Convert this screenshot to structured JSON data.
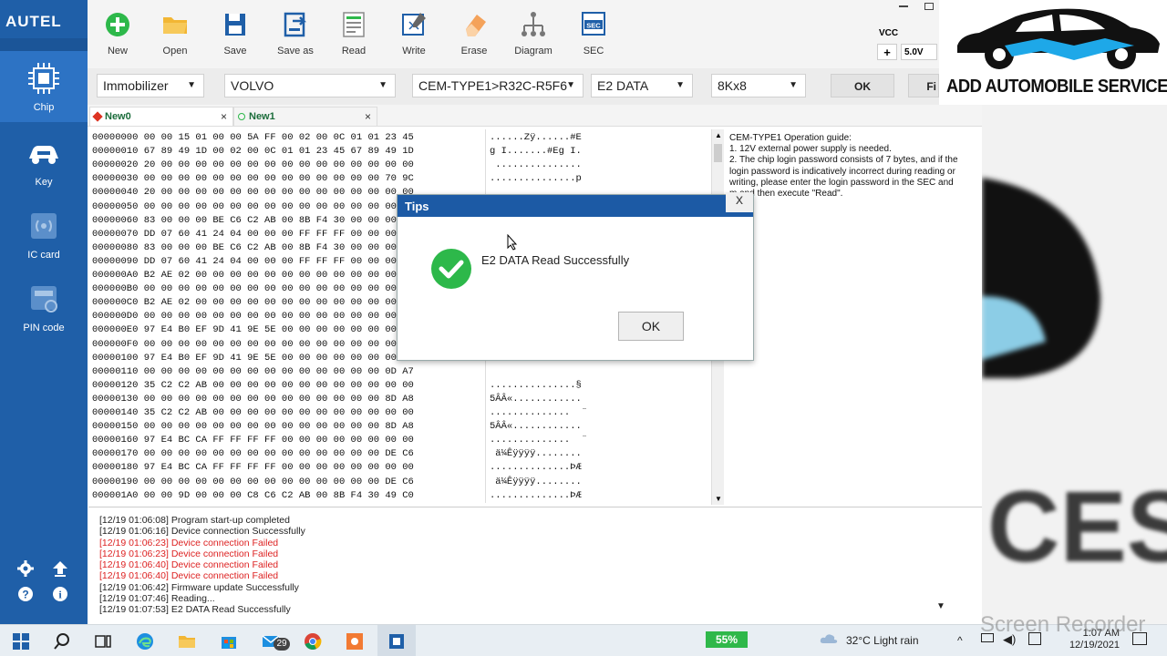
{
  "sidebar": {
    "logo": "AUTEL",
    "items": [
      {
        "label": "Chip",
        "icon": "chip-icon"
      },
      {
        "label": "Key",
        "icon": "car-key-icon"
      },
      {
        "label": "IC card",
        "icon": "ic-card-icon"
      },
      {
        "label": "PIN code",
        "icon": "pin-code-icon"
      }
    ]
  },
  "toolbar": {
    "tools": [
      {
        "label": "New",
        "icon": "plus-circle-icon"
      },
      {
        "label": "Open",
        "icon": "folder-icon"
      },
      {
        "label": "Save",
        "icon": "floppy-icon"
      },
      {
        "label": "Save as",
        "icon": "save-as-icon"
      },
      {
        "label": "Read",
        "icon": "read-icon"
      },
      {
        "label": "Write",
        "icon": "write-icon"
      },
      {
        "label": "Erase",
        "icon": "eraser-icon"
      },
      {
        "label": "Diagram",
        "icon": "diagram-icon"
      },
      {
        "label": "SEC",
        "icon": "sec-icon"
      }
    ],
    "vcc_label": "VCC",
    "vcc_plus": "+",
    "vcc_value": "5.0V"
  },
  "selectors": {
    "function": "Immobilizer",
    "brand": "VOLVO",
    "module": "CEM-TYPE1>R32C-R5F6",
    "data": "E2 DATA",
    "size": "8Kx8",
    "ok_label": "OK",
    "next_label": "Fi"
  },
  "brand_panel": {
    "text": "ADD AUTOMOBILE SERVICES",
    "blur_text": "CES"
  },
  "tabs": [
    {
      "label": "New0",
      "close": "×"
    },
    {
      "label": "New1",
      "close": "×"
    }
  ],
  "hex_rows": [
    "00000000 00 00 15 01 00 00 5A FF 00 02 00 0C 01 01 23 45",
    "00000010 67 89 49 1D 00 02 00 0C 01 01 23 45 67 89 49 1D",
    "00000020 20 00 00 00 00 00 00 00 00 00 00 00 00 00 00 00",
    "00000030 00 00 00 00 00 00 00 00 00 00 00 00 00 00 70 9C",
    "00000040 20 00 00 00 00 00 00 00 00 00 00 00 00 00 00 00",
    "00000050 00 00 00 00 00 00 00 00 00 00 00 00 00 00 00 00",
    "00000060 83 00 00 00 BE C6 C2 AB 00 8B F4 30 00 00 00 00",
    "00000070 DD 07 60 41 24 04 00 00 00 FF FF FF 00 00 00 00",
    "00000080 83 00 00 00 BE C6 C2 AB 00 8B F4 30 00 00 00 00",
    "00000090 DD 07 60 41 24 04 00 00 00 FF FF FF 00 00 00 00",
    "000000A0 B2 AE 02 00 00 00 00 00 00 00 00 00 00 00 00 00",
    "000000B0 00 00 00 00 00 00 00 00 00 00 00 00 00 00 00 00",
    "000000C0 B2 AE 02 00 00 00 00 00 00 00 00 00 00 00 00 00",
    "000000D0 00 00 00 00 00 00 00 00 00 00 00 00 00 00 00 00",
    "000000E0 97 E4 B0 EF 9D 41 9E 5E 00 00 00 00 00 00 00 00",
    "000000F0 00 00 00 00 00 00 00 00 00 00 00 00 00 00 00 00",
    "00000100 97 E4 B0 EF 9D 41 9E 5E 00 00 00 00 00 00 00 00",
    "00000110 00 00 00 00 00 00 00 00 00 00 00 00 00 00 0D A7",
    "00000120 35 C2 C2 AB 00 00 00 00 00 00 00 00 00 00 00 00",
    "00000130 00 00 00 00 00 00 00 00 00 00 00 00 00 00 8D A8",
    "00000140 35 C2 C2 AB 00 00 00 00 00 00 00 00 00 00 00 00",
    "00000150 00 00 00 00 00 00 00 00 00 00 00 00 00 00 8D A8",
    "00000160 97 E4 BC CA FF FF FF FF 00 00 00 00 00 00 00 00",
    "00000170 00 00 00 00 00 00 00 00 00 00 00 00 00 00 DE C6",
    "00000180 97 E4 BC CA FF FF FF FF 00 00 00 00 00 00 00 00",
    "00000190 00 00 00 00 00 00 00 00 00 00 00 00 00 00 DE C6",
    "000001A0 00 00 9D 00 00 00 C8 C6 C2 AB 00 8B F4 30 49 C0"
  ],
  "ascii_rows": [
    "......Zÿ......#E",
    "g I.......#Eg I.",
    " ...............",
    "...............p",
    "",
    "",
    "",
    "",
    "",
    "",
    "",
    "",
    "",
    "",
    "",
    "",
    "",
    "",
    "...............§",
    "5ÂÂ«............",
    "..............  ¨",
    "5ÂÂ«............",
    "..............  ¨",
    " ä¼Êÿÿÿÿ........",
    "..............ÞÆ",
    " ä¼Êÿÿÿÿ........",
    "..............ÞÆ",
    ".. ...ÈÆÂ«. ô0IÀ"
  ],
  "guide": {
    "title": "CEM-TYPE1 Operation guide:",
    "line1": "1. 12V external power supply is needed.",
    "line2": "2. The chip login password consists of 7 bytes, and if the login password is indicatively incorrect during reading or writing, please enter the login password in the SEC and",
    "line3": "m and then execute \"Read\"."
  },
  "log": [
    {
      "text": "[12/19 01:06:08] Program start-up completed",
      "status": "ok"
    },
    {
      "text": "[12/19 01:06:16] Device connection Successfully",
      "status": "ok"
    },
    {
      "text": "[12/19 01:06:23] Device connection Failed",
      "status": "err"
    },
    {
      "text": "[12/19 01:06:23] Device connection Failed",
      "status": "err"
    },
    {
      "text": "[12/19 01:06:40] Device connection Failed",
      "status": "err"
    },
    {
      "text": "[12/19 01:06:40] Device connection Failed",
      "status": "err"
    },
    {
      "text": "[12/19 01:06:42] Firmware update Successfully",
      "status": "ok"
    },
    {
      "text": "[12/19 01:07:46] Reading...",
      "status": "ok"
    },
    {
      "text": "[12/19 01:07:53] E2 DATA Read Successfully",
      "status": "ok"
    }
  ],
  "dialog": {
    "title": "Tips",
    "close": "x",
    "message": "E2 DATA Read Successfully",
    "ok": "OK"
  },
  "taskbar": {
    "battery": "55%",
    "badge": "29",
    "weather": "32°C  Light rain",
    "time": "1:07 AM",
    "date": "12/19/2021",
    "watermark": "Screen Recorder"
  },
  "colors": {
    "sidebar": "#1f5fa8",
    "dialog_title": "#1c5aa5",
    "success": "#2db84a",
    "error": "#d22222"
  }
}
